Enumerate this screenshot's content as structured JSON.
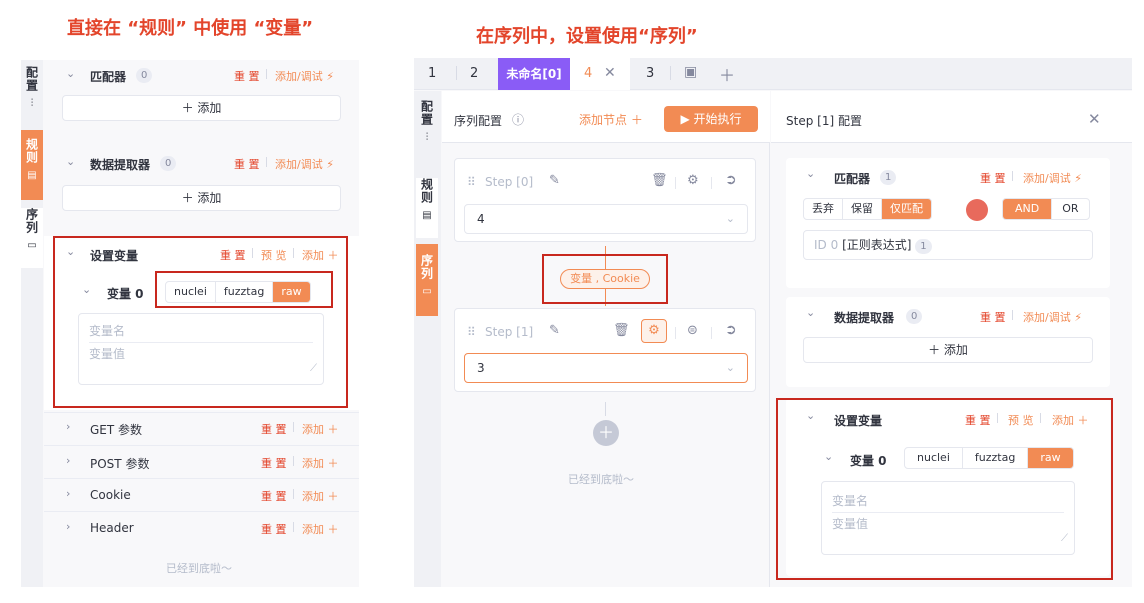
{
  "captions": {
    "left": "直接在 “规则” 中使用 “变量”",
    "right": "在序列中，设置使用“序列”"
  },
  "left_panel": {
    "side_tabs": [
      {
        "label": "配置",
        "icon": "sliders-icon"
      },
      {
        "label": "规则",
        "icon": "clipboard-icon"
      },
      {
        "label": "序列",
        "icon": "stack-icon"
      }
    ],
    "matcher": {
      "title": "匹配器",
      "count": "0",
      "reset": "重 置",
      "add_debug": "添加/调试",
      "add": "添加"
    },
    "extractor": {
      "title": "数据提取器",
      "count": "0",
      "reset": "重 置",
      "add_debug": "添加/调试",
      "add": "添加"
    },
    "set_var": {
      "title": "设置变量",
      "reset": "重 置",
      "preview": "预 览",
      "add": "添加",
      "var_label": "变量 0",
      "seg": [
        "nuclei",
        "fuzztag",
        "raw"
      ],
      "name_placeholder": "变量名",
      "value_placeholder": "变量值"
    },
    "sections": [
      {
        "title": "GET 参数",
        "reset": "重 置",
        "add": "添加"
      },
      {
        "title": "POST 参数",
        "reset": "重 置",
        "add": "添加"
      },
      {
        "title": "Cookie",
        "reset": "重 置",
        "add": "添加"
      },
      {
        "title": "Header",
        "reset": "重 置",
        "add": "添加"
      }
    ],
    "bottom_text": "已经到底啦～"
  },
  "tabs": {
    "items": [
      "1",
      "2",
      "未命名[0]",
      "4",
      "3"
    ],
    "active_label": "未命名[0]"
  },
  "sequence": {
    "title": "序列配置",
    "add_node": "添加节点",
    "run": "开始执行",
    "steps": [
      {
        "name": "Step [0]",
        "value": "4"
      },
      {
        "name": "Step [1]",
        "value": "3"
      }
    ],
    "link_label": "变量 , Cookie",
    "bottom_text": "已经到底啦～"
  },
  "step_config": {
    "title": "Step [1] 配置",
    "matcher": {
      "title": "匹配器",
      "count": "1",
      "reset": "重 置",
      "add_debug": "添加/调试",
      "seg": [
        "丢弃",
        "保留",
        "仅匹配"
      ],
      "logic": [
        "AND",
        "OR"
      ],
      "rule_id": "ID 0",
      "rule_text": "[正则表达式]",
      "rule_count": "1"
    },
    "extractor": {
      "title": "数据提取器",
      "count": "0",
      "reset": "重 置",
      "add_debug": "添加/调试",
      "add": "添加"
    },
    "set_var": {
      "title": "设置变量",
      "reset": "重 置",
      "preview": "预 览",
      "add": "添加",
      "var_label": "变量 0",
      "seg": [
        "nuclei",
        "fuzztag",
        "raw"
      ],
      "name_placeholder": "变量名",
      "value_placeholder": "变量值"
    }
  },
  "colors": {
    "accent": "#f28b54",
    "caption": "#e3452b",
    "highlight_box": "#c8281e",
    "tab_active": "#8a5cf6"
  }
}
